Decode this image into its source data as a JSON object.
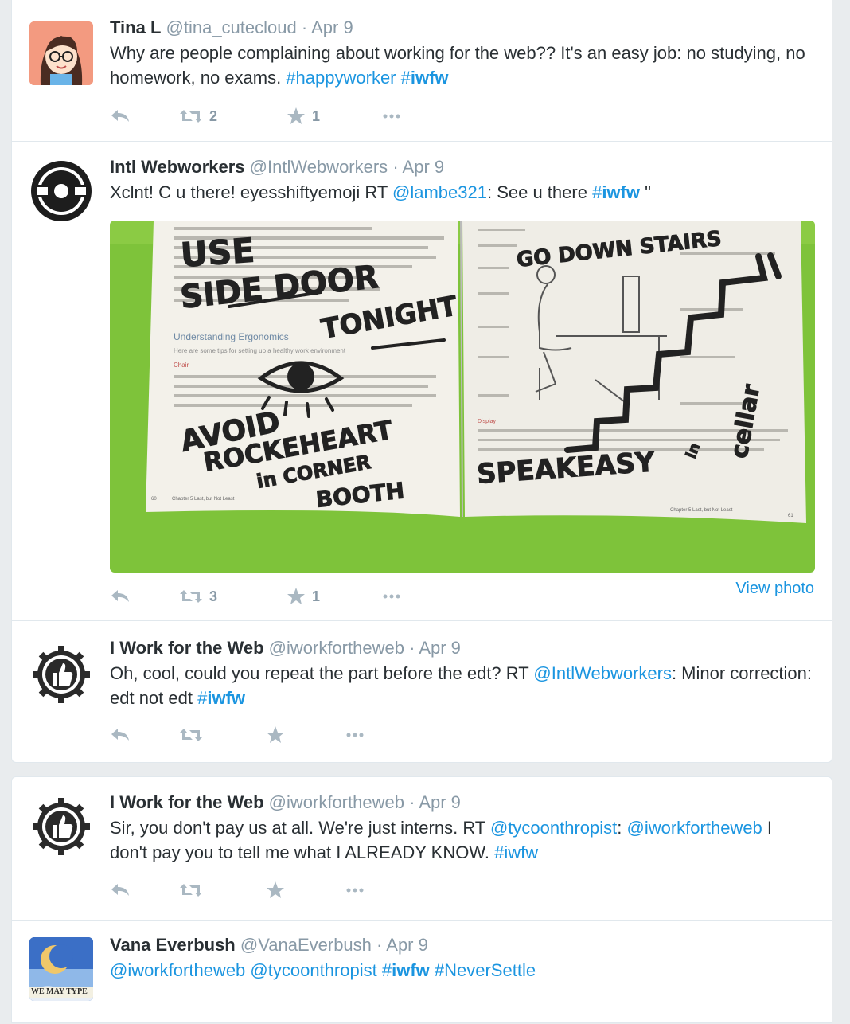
{
  "colors": {
    "link": "#1b95e0",
    "meta": "#8899a6",
    "icon": "#aab8c2",
    "text": "#292f33"
  },
  "tweets": [
    {
      "name": "Tina L",
      "handle": "@tina_cutecloud",
      "sep": "·",
      "time": "Apr 9",
      "parts": [
        {
          "t": "Why are people complaining about working for the web?? It's an easy job: no studying, no homework, no exams. "
        },
        {
          "t": "#happyworker",
          "k": "tag"
        },
        {
          "t": " "
        },
        {
          "t": "#",
          "k": "tag"
        },
        {
          "t": "iwfw",
          "k": "tagb"
        }
      ],
      "retweets": "2",
      "favorites": "1",
      "avatar_icon": "cartoon-girl-avatar"
    },
    {
      "name": "Intl Webworkers",
      "handle": "@IntlWebworkers",
      "sep": "·",
      "time": "Apr 9",
      "parts": [
        {
          "t": "Xclnt! C u there! eyesshiftyemoji RT "
        },
        {
          "t": "@lambe321",
          "k": "link"
        },
        {
          "t": ": See u there "
        },
        {
          "t": "#",
          "k": "tag"
        },
        {
          "t": "iwfw",
          "k": "tagb"
        },
        {
          "t": " \""
        }
      ],
      "retweets": "3",
      "favorites": "1",
      "view_photo": "View photo",
      "avatar_icon": "iwfw-badge-avatar",
      "photo": {
        "left_heading": "Understanding Ergonomics",
        "left_sub": "Here are some tips for setting up a healthy work environment",
        "chair_label": "Chair",
        "display_label": "Display",
        "footer_left_page": "60",
        "footer_left": "Chapter 5  Last, but Not Least",
        "footer_right": "Chapter 5  Last, but Not Least",
        "footer_right_page": "61",
        "scrawl_use": "USE",
        "scrawl_side_door": "SIDE DOOR",
        "scrawl_tonight": "TONIGHT",
        "scrawl_avoid": "AVOID",
        "scrawl_rockeheart": "ROCKEHEART",
        "scrawl_in_corner": "in CORNER",
        "scrawl_booth": "BOOTH",
        "scrawl_go_down": "GO DOWN STAIRS",
        "scrawl_speakeasy": "SPEAKEASY",
        "scrawl_in": "in",
        "scrawl_cellar": "cellar"
      }
    },
    {
      "name": "I Work for the Web",
      "handle": "@iworkfortheweb",
      "sep": "·",
      "time": "Apr 9",
      "parts": [
        {
          "t": "Oh, cool, could you repeat the part before the edt? RT "
        },
        {
          "t": "@IntlWebworkers",
          "k": "link"
        },
        {
          "t": ": Minor correction: edt not edt "
        },
        {
          "t": "#",
          "k": "tag"
        },
        {
          "t": "iwfw",
          "k": "tagb"
        }
      ],
      "retweets": "",
      "favorites": "",
      "avatar_icon": "thumbs-up-gear-avatar"
    },
    {
      "name": "I Work for the Web",
      "handle": "@iworkfortheweb",
      "sep": "·",
      "time": "Apr 9",
      "parts": [
        {
          "t": "Sir, you don't pay us at all. We're just interns. RT "
        },
        {
          "t": "@tycoonthropist",
          "k": "link"
        },
        {
          "t": ": "
        },
        {
          "t": "@iworkfortheweb",
          "k": "link"
        },
        {
          "t": " I don't pay you to tell me what I ALREADY KNOW. "
        },
        {
          "t": "#iwfw",
          "k": "tag"
        }
      ],
      "retweets": "",
      "favorites": "",
      "avatar_icon": "thumbs-up-gear-avatar"
    },
    {
      "name": "Vana Everbush",
      "handle": "@VanaEverbush",
      "sep": "·",
      "time": "Apr 9",
      "parts": [
        {
          "t": "@iworkfortheweb",
          "k": "link"
        },
        {
          "t": " "
        },
        {
          "t": "@tycoonthropist",
          "k": "link"
        },
        {
          "t": " "
        },
        {
          "t": "#",
          "k": "tag"
        },
        {
          "t": "iwfw",
          "k": "tagb"
        },
        {
          "t": " "
        },
        {
          "t": "#NeverSettle",
          "k": "tag"
        }
      ],
      "avatar_text": "WE MAY TYPE",
      "avatar_icon": "moon-globe-avatar"
    }
  ]
}
